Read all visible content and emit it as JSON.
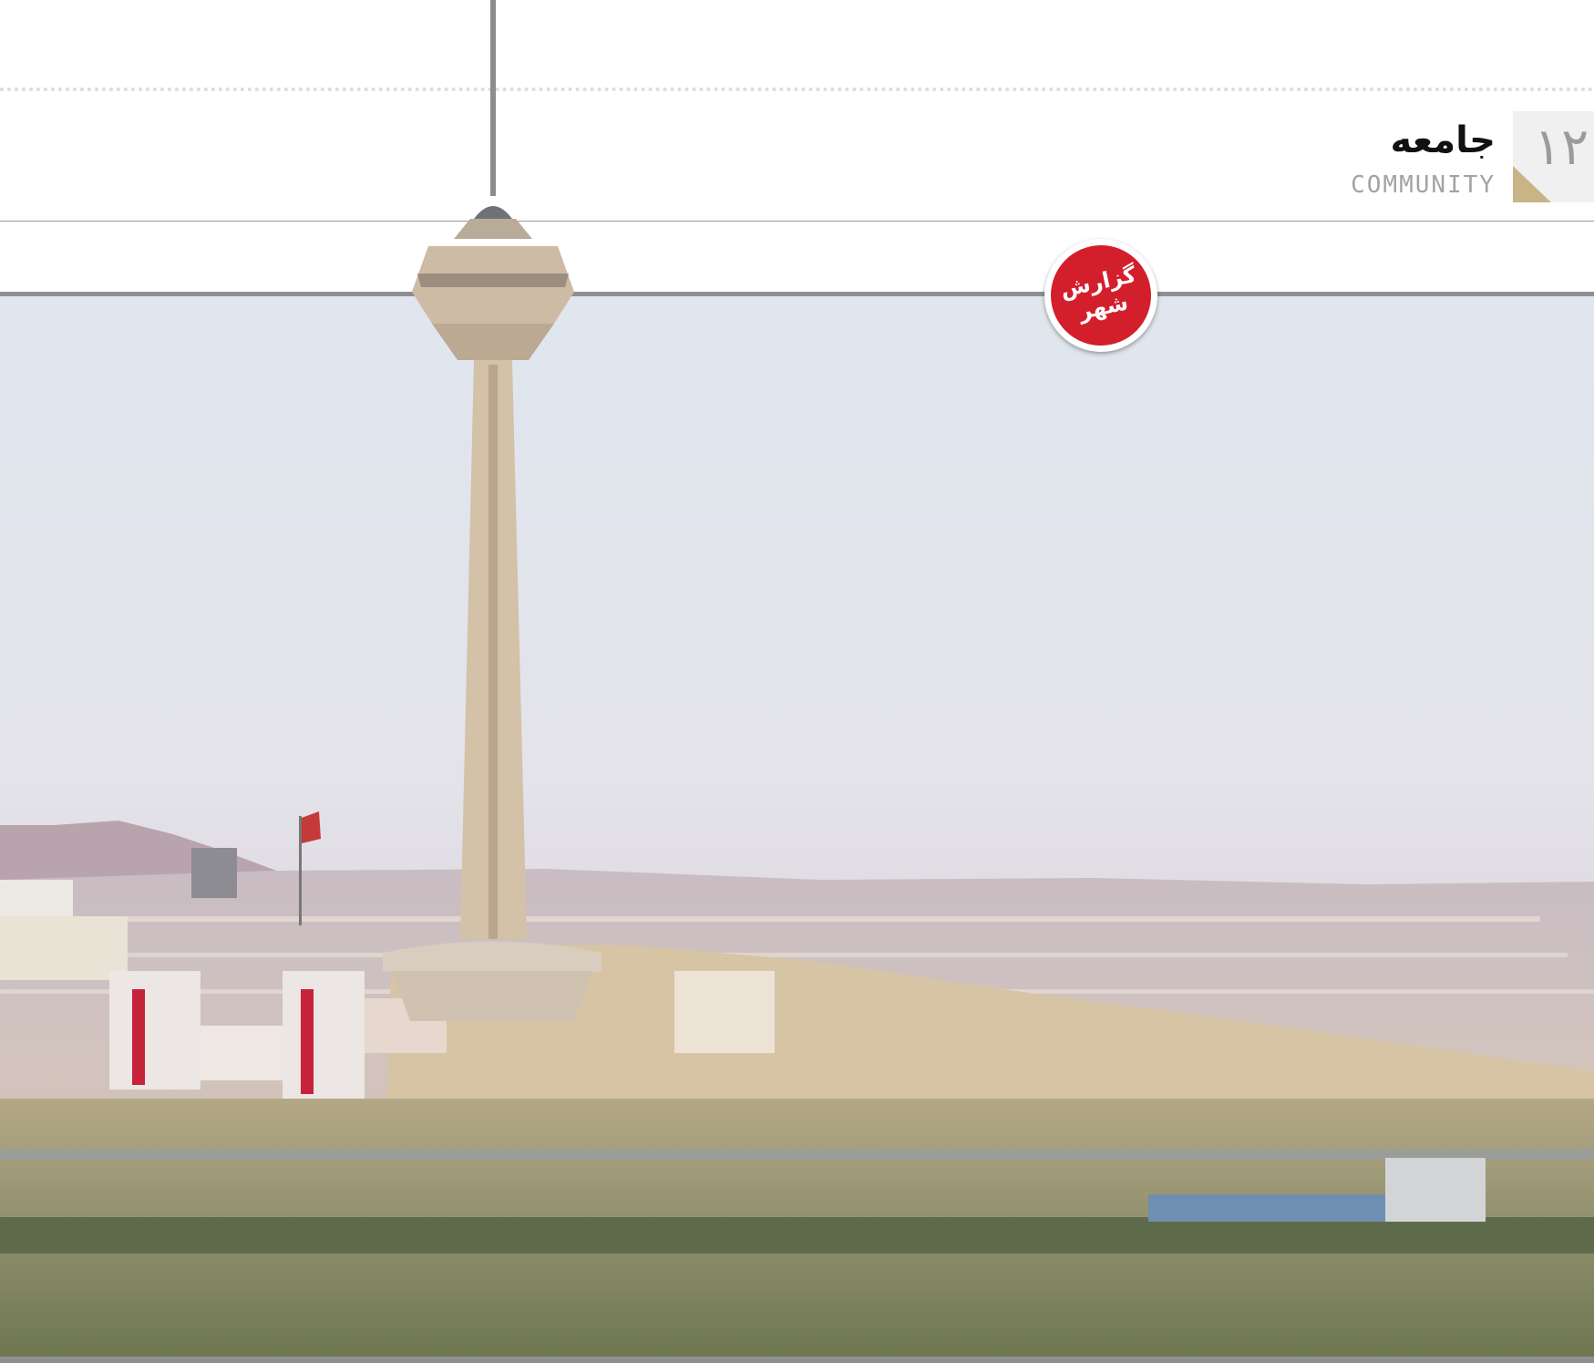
{
  "header": {
    "section_title": "جامعه",
    "section_subtitle": "COMMUNITY",
    "page_number": "۱۲"
  },
  "badge": {
    "line1": "گزارش",
    "line2": "شهر"
  },
  "colors": {
    "badge_red": "#d31f2b",
    "corner_gold": "#c9b487",
    "rule_gray": "#8f8f92"
  },
  "photo": {
    "subject": "milad-tower-tehran-skyline"
  }
}
